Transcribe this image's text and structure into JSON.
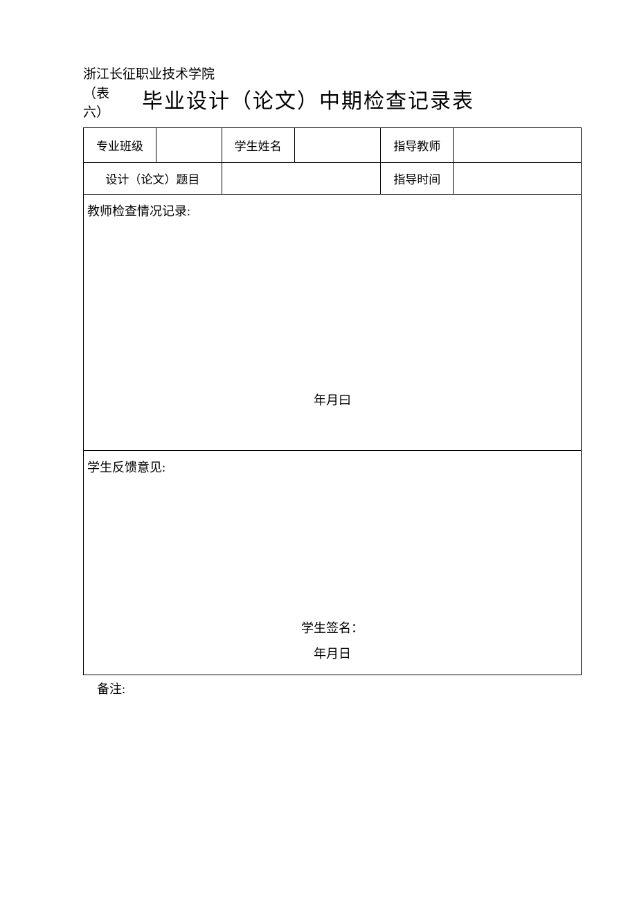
{
  "header": {
    "institution": "浙江长征职业技术学院",
    "form_number": "（表六）",
    "title": "毕业设计（论文）中期检查记录表"
  },
  "row1": {
    "major_label": "专业班级",
    "major_value": "",
    "name_label": "学生姓名",
    "name_value": "",
    "advisor_label": "指导教师",
    "advisor_value": ""
  },
  "row2": {
    "topic_label": "设计（论文）题目",
    "topic_value": "",
    "guide_time_label": "指导时间",
    "guide_time_value": ""
  },
  "teacher_section": {
    "label": "教师检查情况记录:",
    "date_text": "年月曰"
  },
  "student_section": {
    "label": "学生反馈意见:",
    "sign_label": "学生签名：",
    "date_text": "年月日"
  },
  "remark": "备注:"
}
